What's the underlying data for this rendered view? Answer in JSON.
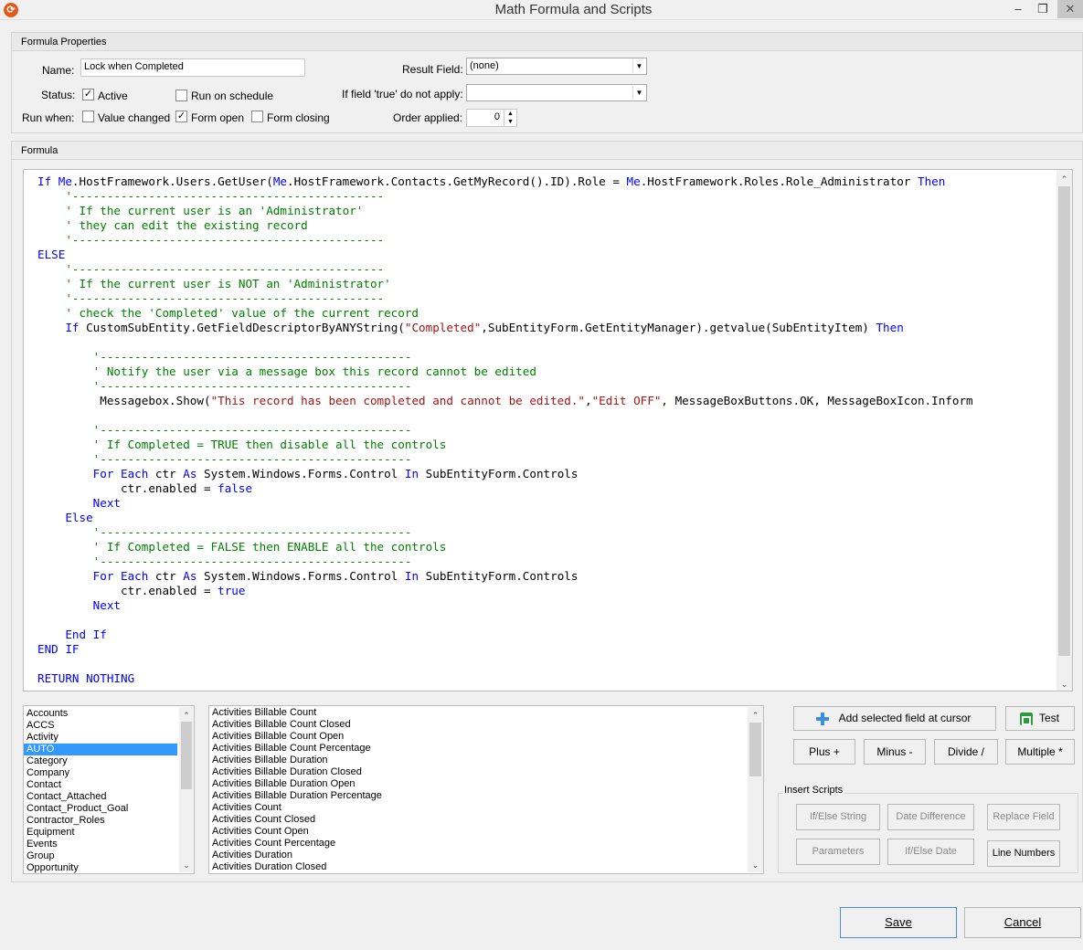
{
  "window": {
    "title": "Math Formula and Scripts",
    "icon": "app-logo-icon",
    "controls": {
      "minimize": "–",
      "restore": "❐",
      "close": "✕"
    }
  },
  "properties": {
    "header": "Formula Properties",
    "name_label": "Name:",
    "name_value": "Lock when Completed",
    "result_field_label": "Result Field:",
    "result_field_value": "(none)",
    "status_label": "Status:",
    "active_label": "Active",
    "active_checked": true,
    "run_schedule_label": "Run on schedule",
    "run_schedule_checked": false,
    "if_true_label": "If field 'true' do not apply:",
    "if_true_value": "",
    "run_when_label": "Run when:",
    "value_changed_label": "Value changed",
    "value_changed_checked": false,
    "form_open_label": "Form open",
    "form_open_checked": true,
    "form_closing_label": "Form closing",
    "form_closing_checked": false,
    "order_label": "Order applied:",
    "order_value": "0"
  },
  "formula": {
    "header": "Formula",
    "code_lines": [
      [
        {
          "t": "If ",
          "c": "kw"
        },
        {
          "t": "Me",
          "c": "kw"
        },
        {
          "t": ".HostFramework.Users.GetUser(",
          "c": ""
        },
        {
          "t": "Me",
          "c": "kw"
        },
        {
          "t": ".HostFramework.Contacts.GetMyRecord().ID).Role = ",
          "c": ""
        },
        {
          "t": "Me",
          "c": "kw"
        },
        {
          "t": ".HostFramework.Roles.Role_Administrator ",
          "c": ""
        },
        {
          "t": "Then",
          "c": "kw"
        }
      ],
      [
        {
          "t": "    '---------------------------------------------",
          "c": "cm"
        }
      ],
      [
        {
          "t": "    ' If the current user is an 'Administrator'",
          "c": "cm"
        }
      ],
      [
        {
          "t": "    ' they can edit the existing record",
          "c": "cm"
        }
      ],
      [
        {
          "t": "    '---------------------------------------------",
          "c": "cm"
        }
      ],
      [
        {
          "t": "ELSE",
          "c": "kw"
        }
      ],
      [
        {
          "t": "    '---------------------------------------------",
          "c": "cm"
        }
      ],
      [
        {
          "t": "    ' If the current user is NOT an 'Administrator'",
          "c": "cm"
        }
      ],
      [
        {
          "t": "    '---------------------------------------------",
          "c": "cm"
        }
      ],
      [
        {
          "t": "    ' check the 'Completed' value of the current record",
          "c": "cm"
        }
      ],
      [
        {
          "t": "    ",
          "c": ""
        },
        {
          "t": "If",
          "c": "kw"
        },
        {
          "t": " CustomSubEntity.GetFieldDescriptorByANYString(",
          "c": ""
        },
        {
          "t": "\"Completed\"",
          "c": "st"
        },
        {
          "t": ",SubEntityForm.GetEntityManager).getvalue(SubEntityItem) ",
          "c": ""
        },
        {
          "t": "Then",
          "c": "kw"
        }
      ],
      [
        {
          "t": "",
          "c": ""
        }
      ],
      [
        {
          "t": "        '---------------------------------------------",
          "c": "cm"
        }
      ],
      [
        {
          "t": "        ' Notify the user via a message box this record cannot be edited",
          "c": "cm"
        }
      ],
      [
        {
          "t": "        '---------------------------------------------",
          "c": "cm"
        }
      ],
      [
        {
          "t": "         Messagebox.Show(",
          "c": ""
        },
        {
          "t": "\"This record has been completed and cannot be edited.\"",
          "c": "st"
        },
        {
          "t": ",",
          "c": ""
        },
        {
          "t": "\"Edit OFF\"",
          "c": "st"
        },
        {
          "t": ", MessageBoxButtons.OK, MessageBoxIcon.Inform",
          "c": ""
        }
      ],
      [
        {
          "t": "",
          "c": ""
        }
      ],
      [
        {
          "t": "        '---------------------------------------------",
          "c": "cm"
        }
      ],
      [
        {
          "t": "        ' If Completed = TRUE then disable all the controls",
          "c": "cm"
        }
      ],
      [
        {
          "t": "        '---------------------------------------------",
          "c": "cm"
        }
      ],
      [
        {
          "t": "        ",
          "c": ""
        },
        {
          "t": "For Each",
          "c": "kw"
        },
        {
          "t": " ctr ",
          "c": ""
        },
        {
          "t": "As",
          "c": "kw"
        },
        {
          "t": " System.Windows.Forms.Control ",
          "c": ""
        },
        {
          "t": "In",
          "c": "kw"
        },
        {
          "t": " SubEntityForm.Controls",
          "c": ""
        }
      ],
      [
        {
          "t": "            ctr.enabled = ",
          "c": ""
        },
        {
          "t": "false",
          "c": "kw"
        }
      ],
      [
        {
          "t": "        ",
          "c": ""
        },
        {
          "t": "Next",
          "c": "kw"
        }
      ],
      [
        {
          "t": "    ",
          "c": ""
        },
        {
          "t": "Else",
          "c": "kw"
        }
      ],
      [
        {
          "t": "        '---------------------------------------------",
          "c": "cm"
        }
      ],
      [
        {
          "t": "        ' If Completed = FALSE then ENABLE all the controls",
          "c": "cm"
        }
      ],
      [
        {
          "t": "        '---------------------------------------------",
          "c": "cm"
        }
      ],
      [
        {
          "t": "        ",
          "c": ""
        },
        {
          "t": "For Each",
          "c": "kw"
        },
        {
          "t": " ctr ",
          "c": ""
        },
        {
          "t": "As",
          "c": "kw"
        },
        {
          "t": " System.Windows.Forms.Control ",
          "c": ""
        },
        {
          "t": "In",
          "c": "kw"
        },
        {
          "t": " SubEntityForm.Controls",
          "c": ""
        }
      ],
      [
        {
          "t": "            ctr.enabled = ",
          "c": ""
        },
        {
          "t": "true",
          "c": "kw"
        }
      ],
      [
        {
          "t": "        ",
          "c": ""
        },
        {
          "t": "Next",
          "c": "kw"
        }
      ],
      [
        {
          "t": "",
          "c": ""
        }
      ],
      [
        {
          "t": "    ",
          "c": ""
        },
        {
          "t": "End If",
          "c": "kw"
        }
      ],
      [
        {
          "t": "END IF",
          "c": "kw"
        }
      ],
      [
        {
          "t": "",
          "c": ""
        }
      ],
      [
        {
          "t": "RETURN NOTHING",
          "c": "kw"
        }
      ]
    ]
  },
  "entities": {
    "items": [
      "Accounts",
      "ACCS",
      "Activity",
      "AUTO",
      "Category",
      "Company",
      "Contact",
      "Contact_Attached",
      "Contact_Product_Goal",
      "Contractor_Roles",
      "Equipment",
      "Events",
      "Group",
      "Opportunity"
    ],
    "selected": "AUTO"
  },
  "fields": {
    "items": [
      "Activities Billable Count",
      "Activities Billable Count Closed",
      "Activities Billable Count Open",
      "Activities Billable Count Percentage",
      "Activities Billable Duration",
      "Activities Billable Duration Closed",
      "Activities Billable Duration Open",
      "Activities Billable Duration Percentage",
      "Activities Count",
      "Activities Count Closed",
      "Activities Count Open",
      "Activities Count Percentage",
      "Activities Duration",
      "Activities Duration Closed"
    ]
  },
  "actions": {
    "add_field": "Add selected field at cursor",
    "test": "Test",
    "plus": "Plus +",
    "minus": "Minus -",
    "divide": "Divide /",
    "multiple": "Multiple *"
  },
  "insert_scripts": {
    "label": "Insert Scripts",
    "if_else_string": "If/Else String",
    "date_difference": "Date Difference",
    "replace_field": "Replace Field",
    "parameters": "Parameters",
    "if_else_date": "If/Else Date",
    "line_numbers": "Line Numbers"
  },
  "footer": {
    "save": "Save",
    "cancel": "Cancel"
  },
  "colors": {
    "keyword": "#0000ff",
    "comment": "#008000",
    "string": "#a31515",
    "selection": "#3399ff",
    "add_icon": "#3b8de0",
    "test_icon": "#2e9b3b"
  }
}
